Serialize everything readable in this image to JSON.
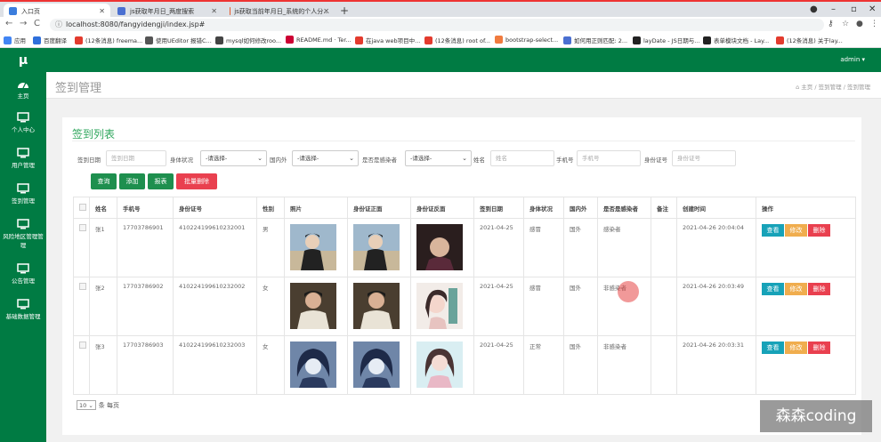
{
  "browser": {
    "tabs": [
      {
        "title": "入口页",
        "active": true,
        "color": "#3b7ddd"
      },
      {
        "title": "js获取年月日_两度搜索",
        "active": false,
        "color": "#4a6fd1"
      },
      {
        "title": "js获取当前年月日_系统的个人分...",
        "active": false,
        "color": "#e55a2b"
      }
    ],
    "url": "localhost:8080/fangyidengji/index.jsp#",
    "bookmarks": [
      {
        "label": "应用",
        "color": "#4285f4"
      },
      {
        "label": "百度翻译",
        "color": "#2f6fdb"
      },
      {
        "label": "(12条消息) freema...",
        "color": "#e33b2e"
      },
      {
        "label": "使用UEditor 报错C...",
        "color": "#555"
      },
      {
        "label": "mysql如何修改roo...",
        "color": "#444"
      },
      {
        "label": "README.md · Ter...",
        "color": "#c03"
      },
      {
        "label": "在java web项目中...",
        "color": "#e33b2e"
      },
      {
        "label": "(12条消息) root of...",
        "color": "#e33b2e"
      },
      {
        "label": "bootstrap-select...",
        "color": "#f07b3f"
      },
      {
        "label": "如何用正则匹配: 2...",
        "color": "#4a6fd1"
      },
      {
        "label": "layDate - JS日期与...",
        "color": "#222"
      },
      {
        "label": "表单模块文档 - Lay...",
        "color": "#222"
      },
      {
        "label": "(12条消息) 关于lay...",
        "color": "#e33b2e"
      }
    ]
  },
  "app": {
    "logo": "μ",
    "user": "admin ▾",
    "brand_color": "#007b43",
    "sidebar": [
      {
        "label": "主页",
        "icon": "dashboard-icon"
      },
      {
        "label": "个人中心",
        "icon": "monitor-icon"
      },
      {
        "label": "用户管理",
        "icon": "monitor-icon"
      },
      {
        "label": "签到管理",
        "icon": "monitor-icon"
      },
      {
        "label": "风险地区管理管理",
        "icon": "monitor-icon"
      },
      {
        "label": "公告管理",
        "icon": "monitor-icon"
      },
      {
        "label": "基础数据管理",
        "icon": "monitor-icon"
      }
    ],
    "page_title": "签到管理",
    "breadcrumb": {
      "home": "主页",
      "sep": "/",
      "b1": "签到管理",
      "b2": "签到管理"
    }
  },
  "list": {
    "title": "签到列表",
    "filters": {
      "date_label": "签到日期",
      "date_placeholder": "签到日期",
      "health_label": "身体状况",
      "health_value": "-请选择-",
      "domestic_label": "国内外",
      "domestic_value": "-请选择-",
      "infected_label": "是否是感染者",
      "infected_value": "-请选择-",
      "name_label": "姓名",
      "name_placeholder": "姓名",
      "phone_label": "手机号",
      "phone_placeholder": "手机号",
      "id_label": "身份证号",
      "id_placeholder": "身份证号"
    },
    "buttons": {
      "query": "查询",
      "add": "添加",
      "report": "报表",
      "batch_delete": "批量删除"
    },
    "columns": [
      "姓名",
      "手机号",
      "身份证号",
      "性别",
      "照片",
      "身份证正面",
      "身份证反面",
      "签到日期",
      "身体状况",
      "国内外",
      "是否是感染者",
      "备注",
      "创建时间",
      "操作"
    ],
    "rows": [
      {
        "name": "张1",
        "phone": "17703786901",
        "idcard": "410224199610232001",
        "gender": "男",
        "date": "2021-04-25",
        "health": "感冒",
        "domestic": "国外",
        "infected": "感染者",
        "note": "",
        "created": "2021-04-26 20:04:04"
      },
      {
        "name": "张2",
        "phone": "17703786902",
        "idcard": "410224199610232002",
        "gender": "女",
        "date": "2021-04-25",
        "health": "感冒",
        "domestic": "国外",
        "infected": "非感染者",
        "note": "",
        "created": "2021-04-26 20:03:49"
      },
      {
        "name": "张3",
        "phone": "17703786903",
        "idcard": "410224199610232003",
        "gender": "女",
        "date": "2021-04-25",
        "health": "正常",
        "domestic": "国外",
        "infected": "非感染者",
        "note": "",
        "created": "2021-04-26 20:03:31"
      }
    ],
    "row_actions": {
      "view": "查看",
      "edit": "修改",
      "delete": "删除"
    },
    "pager": {
      "size": "10",
      "suffix": "条 每页"
    }
  },
  "watermark": "森森coding"
}
